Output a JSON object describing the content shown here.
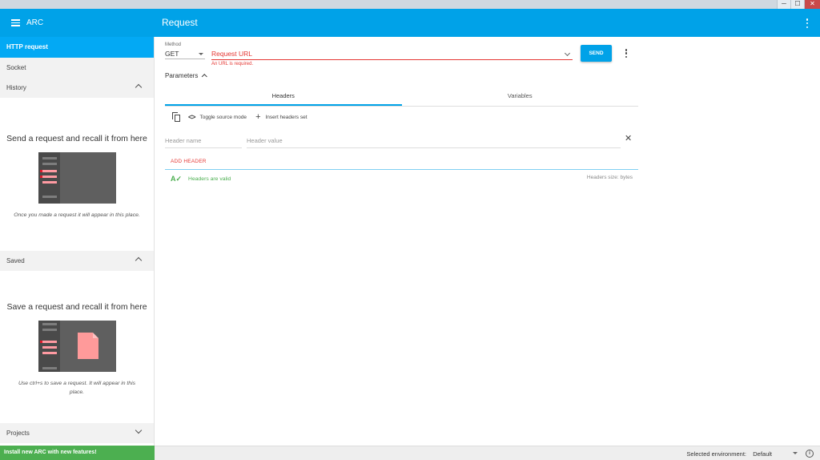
{
  "window": {
    "min": "─",
    "max": "☐",
    "close": "✕"
  },
  "appbar": {
    "brand": "ARC",
    "title": "Request"
  },
  "sidebar": {
    "http_request": "HTTP request",
    "socket": "Socket",
    "history": {
      "label": "History",
      "empty_title": "Send a request and recall it from here",
      "empty_text": "Once you made a request it will appear in this place."
    },
    "saved": {
      "label": "Saved",
      "empty_title": "Save a request and recall it from here",
      "empty_text": "Use ctrl+s to save a request. It will appear in this place."
    },
    "projects": {
      "label": "Projects"
    },
    "install": "Install new ARC with new features!"
  },
  "request": {
    "method_label": "Method",
    "method": "GET",
    "url_placeholder": "Request URL",
    "url_error": "An URL is required.",
    "send": "SEND",
    "parameters": "Parameters"
  },
  "tabs": [
    {
      "label": "Headers",
      "active": true
    },
    {
      "label": "Variables",
      "active": false
    }
  ],
  "toolbar": {
    "toggle_source": "Toggle source mode",
    "insert_headers": "Insert headers set"
  },
  "headers": {
    "name_placeholder": "Header name",
    "value_placeholder": "Header value",
    "add_header": "ADD HEADER",
    "valid": "Headers are valid",
    "size": "Headers size: bytes"
  },
  "status": {
    "env_label": "Selected environment:",
    "env_value": "Default"
  },
  "colors": {
    "primary": "#00a2e8",
    "active_nav": "#03a9f4",
    "error": "#e53935",
    "success": "#4caf50"
  }
}
